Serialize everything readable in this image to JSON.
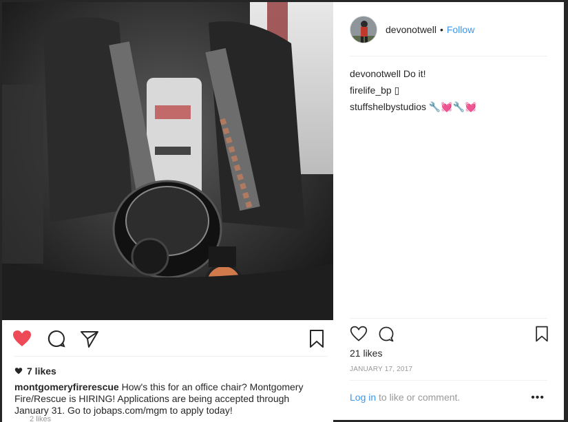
{
  "post": {
    "author": "devonotwell",
    "follow_label": "Follow",
    "separator": "•",
    "comments": [
      {
        "user": "devonotwell",
        "text": "Do it!"
      },
      {
        "user": "firelife_bp",
        "text": "▯"
      },
      {
        "user": "stuffshelbystudios",
        "text": "🔧💓🔧💓"
      }
    ],
    "likes_label": "21 likes",
    "date": "JANUARY 17, 2017",
    "footer": {
      "login_link": "Log in",
      "login_suffix": " to like or comment.",
      "more_label": "•••"
    }
  },
  "underlying_post": {
    "likes_label": "7 likes",
    "caption_user": "montgomeryfirerescue",
    "caption_text": "How's this for an office chair? Montgomery Fire/Rescue is HIRING! Applications are being accepted through January 31. Go to jobaps.com/mgm to apply today!",
    "faded_text": "2 likes"
  },
  "colors": {
    "link_blue": "#3897f0",
    "like_red": "#ed4956",
    "muted_gray": "#999999",
    "backdrop": "#262626"
  },
  "icons": [
    "heart-filled-icon",
    "comment-icon",
    "share-icon",
    "bookmark-icon",
    "heart-outline-icon",
    "more-icon"
  ]
}
